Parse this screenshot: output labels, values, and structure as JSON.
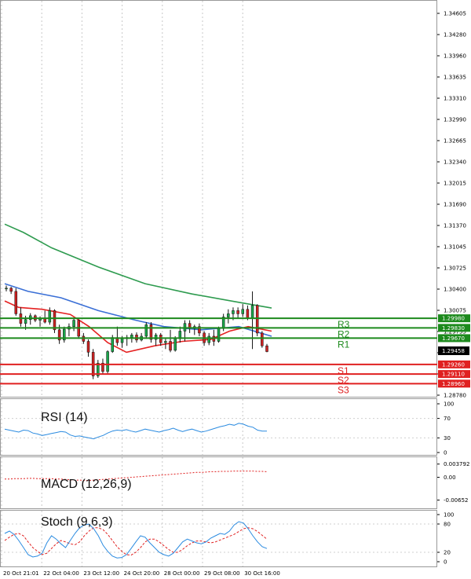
{
  "chart_data": [
    {
      "type": "candlestick",
      "panel": "price",
      "ylim": [
        1.2878,
        1.3485
      ],
      "y_ticks": [
        "1.34605",
        "1.34280",
        "1.33960",
        "1.33635",
        "1.33310",
        "1.32990",
        "1.32665",
        "1.32340",
        "1.32015",
        "1.31690",
        "1.31370",
        "1.31045",
        "1.30725",
        "1.30400",
        "1.30075",
        "1.29755",
        "1.29430",
        "1.29105",
        "1.28780"
      ],
      "x_ticks": [
        "20 Oct 21:01",
        "22 Oct 04:00",
        "23 Oct 12:00",
        "24 Oct 20:00",
        "28 Oct 00:00",
        "29 Oct 08:00",
        "30 Oct 16:00"
      ],
      "candles": [
        [
          1.3045,
          1.3049,
          1.304,
          1.3045
        ],
        [
          1.3045,
          1.3047,
          1.3036,
          1.304
        ],
        [
          1.304,
          1.3045,
          1.3002,
          1.3005
        ],
        [
          1.3005,
          1.3015,
          1.2985,
          1.299
        ],
        [
          1.299,
          1.3002,
          1.298,
          1.2996
        ],
        [
          1.2996,
          1.3006,
          1.2988,
          1.3002
        ],
        [
          1.3002,
          1.3004,
          1.2992,
          1.2995
        ],
        [
          1.2995,
          1.3001,
          1.2985,
          1.2998
        ],
        [
          1.2998,
          1.301,
          1.299,
          1.2992
        ],
        [
          1.2992,
          1.3015,
          1.2988,
          1.301
        ],
        [
          1.301,
          1.3012,
          1.2975,
          1.298
        ],
        [
          1.298,
          1.2988,
          1.2958,
          1.2964
        ],
        [
          1.2964,
          1.2985,
          1.296,
          1.2981
        ],
        [
          1.2981,
          1.299,
          1.297,
          1.2985
        ],
        [
          1.2985,
          1.2998,
          1.2978,
          1.2995
        ],
        [
          1.2995,
          1.2996,
          1.2966,
          1.297
        ],
        [
          1.297,
          1.2975,
          1.2958,
          1.2962
        ],
        [
          1.2962,
          1.2965,
          1.2938,
          1.2945
        ],
        [
          1.2945,
          1.295,
          1.2903,
          1.2908
        ],
        [
          1.2908,
          1.2933,
          1.2905,
          1.2928
        ],
        [
          1.2928,
          1.2935,
          1.291,
          1.2915
        ],
        [
          1.2915,
          1.2948,
          1.2912,
          1.2946
        ],
        [
          1.2946,
          1.2972,
          1.2944,
          1.2968
        ],
        [
          1.2968,
          1.2985,
          1.2955,
          1.296
        ],
        [
          1.296,
          1.297,
          1.2952,
          1.2966
        ],
        [
          1.2966,
          1.2972,
          1.2955,
          1.2968
        ],
        [
          1.2968,
          1.2975,
          1.296,
          1.2972
        ],
        [
          1.2972,
          1.2976,
          1.296,
          1.2964
        ],
        [
          1.2964,
          1.2975,
          1.2962,
          1.297
        ],
        [
          1.297,
          1.2992,
          1.2966,
          1.2988
        ],
        [
          1.2988,
          1.2992,
          1.296,
          1.2965
        ],
        [
          1.2965,
          1.2975,
          1.2955,
          1.2972
        ],
        [
          1.2972,
          1.2975,
          1.2955,
          1.296
        ],
        [
          1.296,
          1.2966,
          1.295,
          1.2962
        ],
        [
          1.2962,
          1.298,
          1.2945,
          1.2948
        ],
        [
          1.2948,
          1.297,
          1.2946,
          1.2966
        ],
        [
          1.2966,
          1.2985,
          1.296,
          1.2978
        ],
        [
          1.2978,
          1.2995,
          1.2962,
          1.299
        ],
        [
          1.299,
          1.2995,
          1.2975,
          1.2982
        ],
        [
          1.2982,
          1.2988,
          1.2972,
          1.2985
        ],
        [
          1.2985,
          1.299,
          1.297,
          1.2975
        ],
        [
          1.2975,
          1.2978,
          1.2955,
          1.296
        ],
        [
          1.296,
          1.2975,
          1.2956,
          1.297
        ],
        [
          1.297,
          1.298,
          1.2955,
          1.2962
        ],
        [
          1.2962,
          1.2985,
          1.296,
          1.2982
        ],
        [
          1.2982,
          1.3005,
          1.2978,
          1.3
        ],
        [
          1.3,
          1.3012,
          1.299,
          1.3005
        ],
        [
          1.3005,
          1.3015,
          1.2995,
          1.301
        ],
        [
          1.301,
          1.3015,
          1.2998,
          1.3005
        ],
        [
          1.3005,
          1.302,
          1.3,
          1.3012
        ],
        [
          1.3012,
          1.3018,
          1.2995,
          1.2998
        ],
        [
          1.2998,
          1.304,
          1.295,
          1.3018
        ],
        [
          1.3018,
          1.302,
          1.297,
          1.2975
        ],
        [
          1.2975,
          1.2978,
          1.2952,
          1.2955
        ],
        [
          1.2955,
          1.2958,
          1.2945,
          1.2946
        ]
      ],
      "ma_series": [
        {
          "color": "#2e9b4f",
          "values": [
            [
              0,
              1.3145
            ],
            [
              4,
              1.3132
            ],
            [
              10,
              1.3108
            ],
            [
              20,
              1.3078
            ],
            [
              30,
              1.3052
            ],
            [
              40,
              1.3036
            ],
            [
              50,
              1.3023
            ],
            [
              57,
              1.3014
            ]
          ]
        },
        {
          "color": "#3a6fd6",
          "values": [
            [
              0,
              1.3052
            ],
            [
              5,
              1.304
            ],
            [
              12,
              1.303
            ],
            [
              20,
              1.301
            ],
            [
              28,
              1.2995
            ],
            [
              34,
              1.2985
            ],
            [
              42,
              1.298
            ],
            [
              50,
              1.2985
            ],
            [
              57,
              1.297
            ]
          ]
        },
        {
          "color": "#e52222",
          "values": [
            [
              0,
              1.3025
            ],
            [
              3,
              1.3015
            ],
            [
              8,
              1.3012
            ],
            [
              14,
              1.3004
            ],
            [
              18,
              1.2985
            ],
            [
              22,
              1.296
            ],
            [
              26,
              1.2945
            ],
            [
              32,
              1.2955
            ],
            [
              38,
              1.2962
            ],
            [
              44,
              1.2965
            ],
            [
              48,
              1.2978
            ],
            [
              52,
              1.2985
            ],
            [
              57,
              1.2978
            ]
          ]
        }
      ],
      "last_price": "1.29458",
      "levels": [
        {
          "name": "R3",
          "value": "1.29980",
          "price": 1.2998,
          "color": "#1d8a1d"
        },
        {
          "name": "R2",
          "value": "1.29830",
          "price": 1.2983,
          "color": "#1d8a1d"
        },
        {
          "name": "R1",
          "value": "1.29670",
          "price": 1.2967,
          "color": "#1d8a1d"
        },
        {
          "name": "S1",
          "value": "1.29260",
          "price": 1.2926,
          "color": "#e02020"
        },
        {
          "name": "S2",
          "value": "1.29110",
          "price": 1.2911,
          "color": "#e02020"
        },
        {
          "name": "S3",
          "value": "1.28960",
          "price": 1.2896,
          "color": "#e02020"
        }
      ]
    },
    {
      "type": "line",
      "panel": "rsi",
      "title": "RSI (14)",
      "ylim": [
        0,
        100
      ],
      "y_ticks": [
        "100",
        "70",
        "30",
        "0"
      ],
      "levels": [
        70,
        30
      ],
      "values": [
        48,
        46,
        44,
        42,
        46,
        45,
        40,
        38,
        35,
        37,
        39,
        41,
        43,
        42,
        36,
        33,
        34,
        32,
        30,
        28,
        32,
        35,
        40,
        44,
        46,
        45,
        47,
        44,
        42,
        45,
        48,
        46,
        44,
        42,
        45,
        47,
        50,
        46,
        43,
        46,
        48,
        45,
        42,
        44,
        47,
        50,
        53,
        55,
        58,
        56,
        60,
        58,
        54,
        52,
        46,
        44,
        44
      ]
    },
    {
      "type": "line",
      "panel": "macd",
      "title": "MACD (12,26,9)",
      "ylim": [
        -0.0073,
        0.0044
      ],
      "y_ticks": [
        "0.003792",
        "0.00",
        "-0.00652"
      ],
      "values": [
        -0.0005,
        -0.0005,
        -0.0004,
        -0.0004,
        -0.0004,
        -0.0003,
        -0.0003,
        -0.0004,
        -0.0004,
        -0.0004,
        -0.0004,
        -0.0005,
        -0.0005,
        -0.0006,
        -0.0007,
        -0.0008,
        -0.0008,
        -0.0009,
        -0.0009,
        -0.0008,
        -0.0007,
        -0.0006,
        -0.0005,
        -0.0004,
        -0.0003,
        -0.0002,
        -0.0001,
        0.0,
        0.0001,
        0.0002,
        0.0003,
        0.0004,
        0.0005,
        0.0006,
        0.0007,
        0.0008,
        0.0009,
        0.001,
        0.0011,
        0.0012,
        0.0013,
        0.0014,
        0.0014,
        0.0015,
        0.0016,
        0.0016,
        0.0017,
        0.0017,
        0.0017,
        0.0018,
        0.0018,
        0.0018,
        0.0018,
        0.0018,
        0.0017,
        0.0017,
        0.0016
      ]
    },
    {
      "type": "line",
      "panel": "stoch",
      "title": "Stoch (9,6,3)",
      "ylim": [
        0,
        100
      ],
      "y_ticks": [
        "100",
        "80",
        "20",
        "0"
      ],
      "levels": [
        80,
        20
      ],
      "k_values": [
        60,
        65,
        58,
        45,
        30,
        15,
        10,
        12,
        18,
        40,
        55,
        48,
        38,
        30,
        45,
        60,
        72,
        78,
        80,
        70,
        55,
        35,
        22,
        12,
        8,
        9,
        15,
        28,
        42,
        55,
        52,
        40,
        30,
        20,
        15,
        12,
        18,
        30,
        42,
        48,
        44,
        40,
        38,
        42,
        50,
        55,
        60,
        58,
        65,
        78,
        85,
        82,
        70,
        55,
        42,
        32,
        28
      ],
      "d_values": [
        45,
        52,
        58,
        60,
        55,
        42,
        30,
        22,
        15,
        18,
        28,
        38,
        45,
        42,
        38,
        36,
        42,
        55,
        65,
        72,
        72,
        68,
        58,
        45,
        32,
        22,
        15,
        14,
        20,
        30,
        42,
        48,
        48,
        42,
        34,
        26,
        20,
        20,
        26,
        34,
        40,
        44,
        44,
        42,
        40,
        42,
        46,
        50,
        54,
        58,
        64,
        70,
        72,
        70,
        64,
        56,
        48
      ]
    }
  ]
}
